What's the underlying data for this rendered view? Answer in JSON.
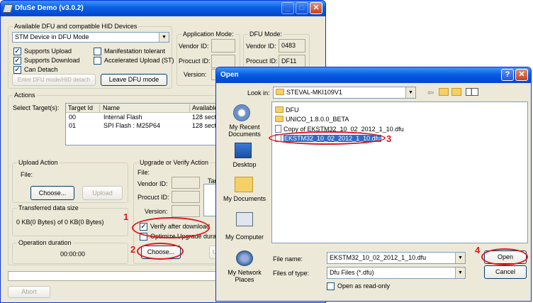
{
  "main_window": {
    "title": "DfuSe Demo (v3.0.2)",
    "devices_legend": "Available DFU and compatible HID Devices",
    "device_selected": "STM Device in DFU Mode",
    "checks": {
      "supports_upload": "Supports Upload",
      "supports_download": "Supports Download",
      "can_detach": "Can Detach",
      "manifestation_tolerant": "Manifestation tolerant",
      "accelerated_upload": "Accelerated Upload (ST)"
    },
    "enter_dfu_btn": "Enter DFU mode/HID detach",
    "leave_dfu_btn": "Leave DFU mode",
    "app_mode": {
      "legend": "Application Mode:",
      "vendor_label": "Vendor ID:",
      "product_label": "Procuct ID:",
      "version_label": "Version:"
    },
    "dfu_mode": {
      "legend": "DFU Mode:",
      "vendor_label": "Vendor ID:",
      "vendor_value": "0483",
      "product_label": "Procuct ID:",
      "product_value": "DF11"
    },
    "actions_legend": "Actions",
    "select_targets_label": "Select Target(s):",
    "targets": {
      "headers": [
        "Target Id",
        "Name",
        "Available"
      ],
      "rows": [
        {
          "id": "00",
          "name": "Internal Flash",
          "avail": "128 sect"
        },
        {
          "id": "01",
          "name": "SPI Flash : M25P64",
          "avail": "128 sect"
        }
      ]
    },
    "upload_action": {
      "legend": "Upload Action",
      "file_label": "File:",
      "choose_btn": "Choose...",
      "upload_btn": "Upload"
    },
    "transferred": {
      "legend": "Transferred data size",
      "value": "0 KB(0 Bytes) of 0 KB(0 Bytes)"
    },
    "operation": {
      "legend": "Operation duration",
      "value": "00:00:00"
    },
    "upgrade": {
      "legend": "Upgrade or Verify Action",
      "file_label": "File:",
      "vendor_label": "Vendor ID:",
      "product_label": "Procuct ID:",
      "version_label": "Version:",
      "targets_label_partial": "Tar",
      "verify_label": "Verify after download",
      "optimize_label": "Optimize Upgrade duratio",
      "choose_btn": "Choose...",
      "upgrade_btn_partial": "U"
    },
    "abort_btn": "Abort"
  },
  "open_dialog": {
    "title": "Open",
    "look_in_label": "Look in:",
    "look_in_value": "STEVAL-MKI109V1",
    "places": [
      {
        "label": "My Recent Documents",
        "icon": "recent-documents-icon"
      },
      {
        "label": "Desktop",
        "icon": "desktop-icon"
      },
      {
        "label": "My Documents",
        "icon": "my-documents-icon"
      },
      {
        "label": "My Computer",
        "icon": "my-computer-icon"
      },
      {
        "label": "My Network Places",
        "icon": "network-places-icon"
      }
    ],
    "files": [
      {
        "name": "DFU",
        "kind": "folder"
      },
      {
        "name": "UNICO_1.8.0.0_BETA",
        "kind": "folder"
      },
      {
        "name": "Copy of EKSTM32_10_02_2012_1_10.dfu",
        "kind": "file"
      },
      {
        "name": "EKSTM32_10_02_2012_1_10.dfu",
        "kind": "file",
        "selected": true
      }
    ],
    "file_name_label": "File name:",
    "file_name_value": "EKSTM32_10_02_2012_1_10.dfu",
    "file_type_label": "Files of type:",
    "file_type_value": "Dfu Files (*.dfu)",
    "readonly_label": "Open as read-only",
    "open_btn": "Open",
    "cancel_btn": "Cancel"
  },
  "annotations": [
    "1",
    "2",
    "3",
    "4"
  ],
  "colors": {
    "accent_red": "#e2141c",
    "title_blue": "#0a5fe0",
    "selection": "#316ac5"
  }
}
